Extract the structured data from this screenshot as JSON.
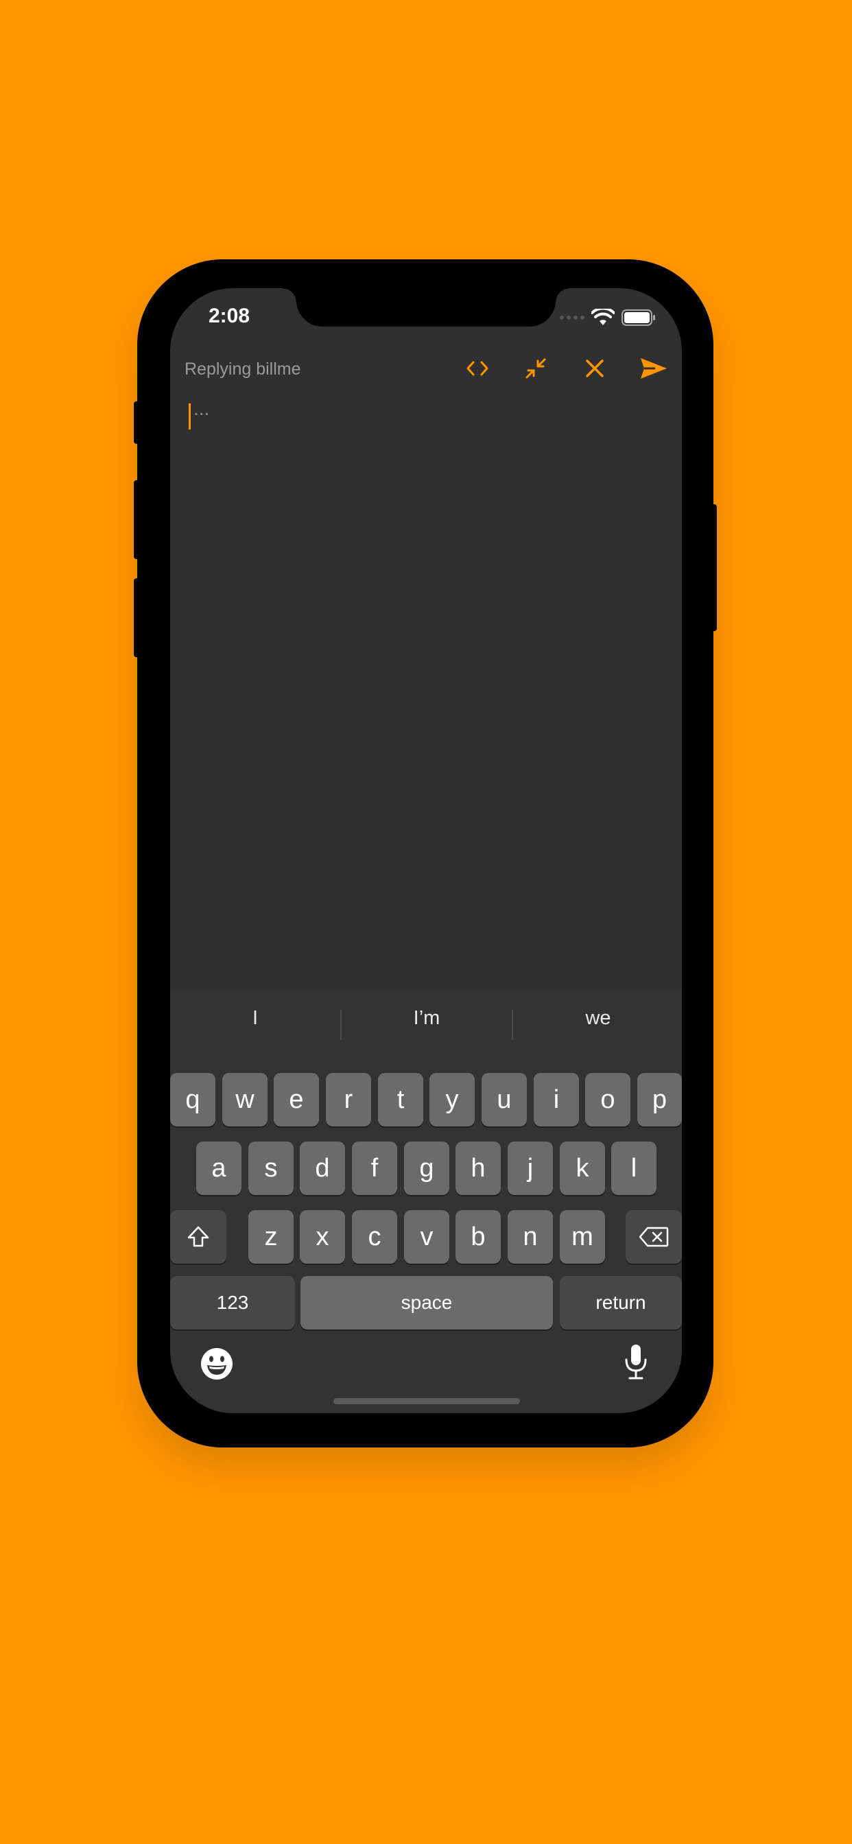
{
  "colors": {
    "accent": "#FF9500",
    "background": "#FF9500",
    "editor_bg": "#303030",
    "key": "#6b6b6b",
    "key_dark": "#474747"
  },
  "status_bar": {
    "time": "2:08"
  },
  "toolbar": {
    "title": "Replying billme",
    "icons": [
      "code-icon",
      "minimize-icon",
      "close-icon",
      "send-icon"
    ]
  },
  "editor": {
    "placeholder": "..."
  },
  "keyboard": {
    "suggestions": [
      "I",
      "I’m",
      "we"
    ],
    "row1": [
      "q",
      "w",
      "e",
      "r",
      "t",
      "y",
      "u",
      "i",
      "o",
      "p"
    ],
    "row2": [
      "a",
      "s",
      "d",
      "f",
      "g",
      "h",
      "j",
      "k",
      "l"
    ],
    "row3": [
      "z",
      "x",
      "c",
      "v",
      "b",
      "n",
      "m"
    ],
    "numbers_label": "123",
    "space_label": "space",
    "return_label": "return"
  }
}
